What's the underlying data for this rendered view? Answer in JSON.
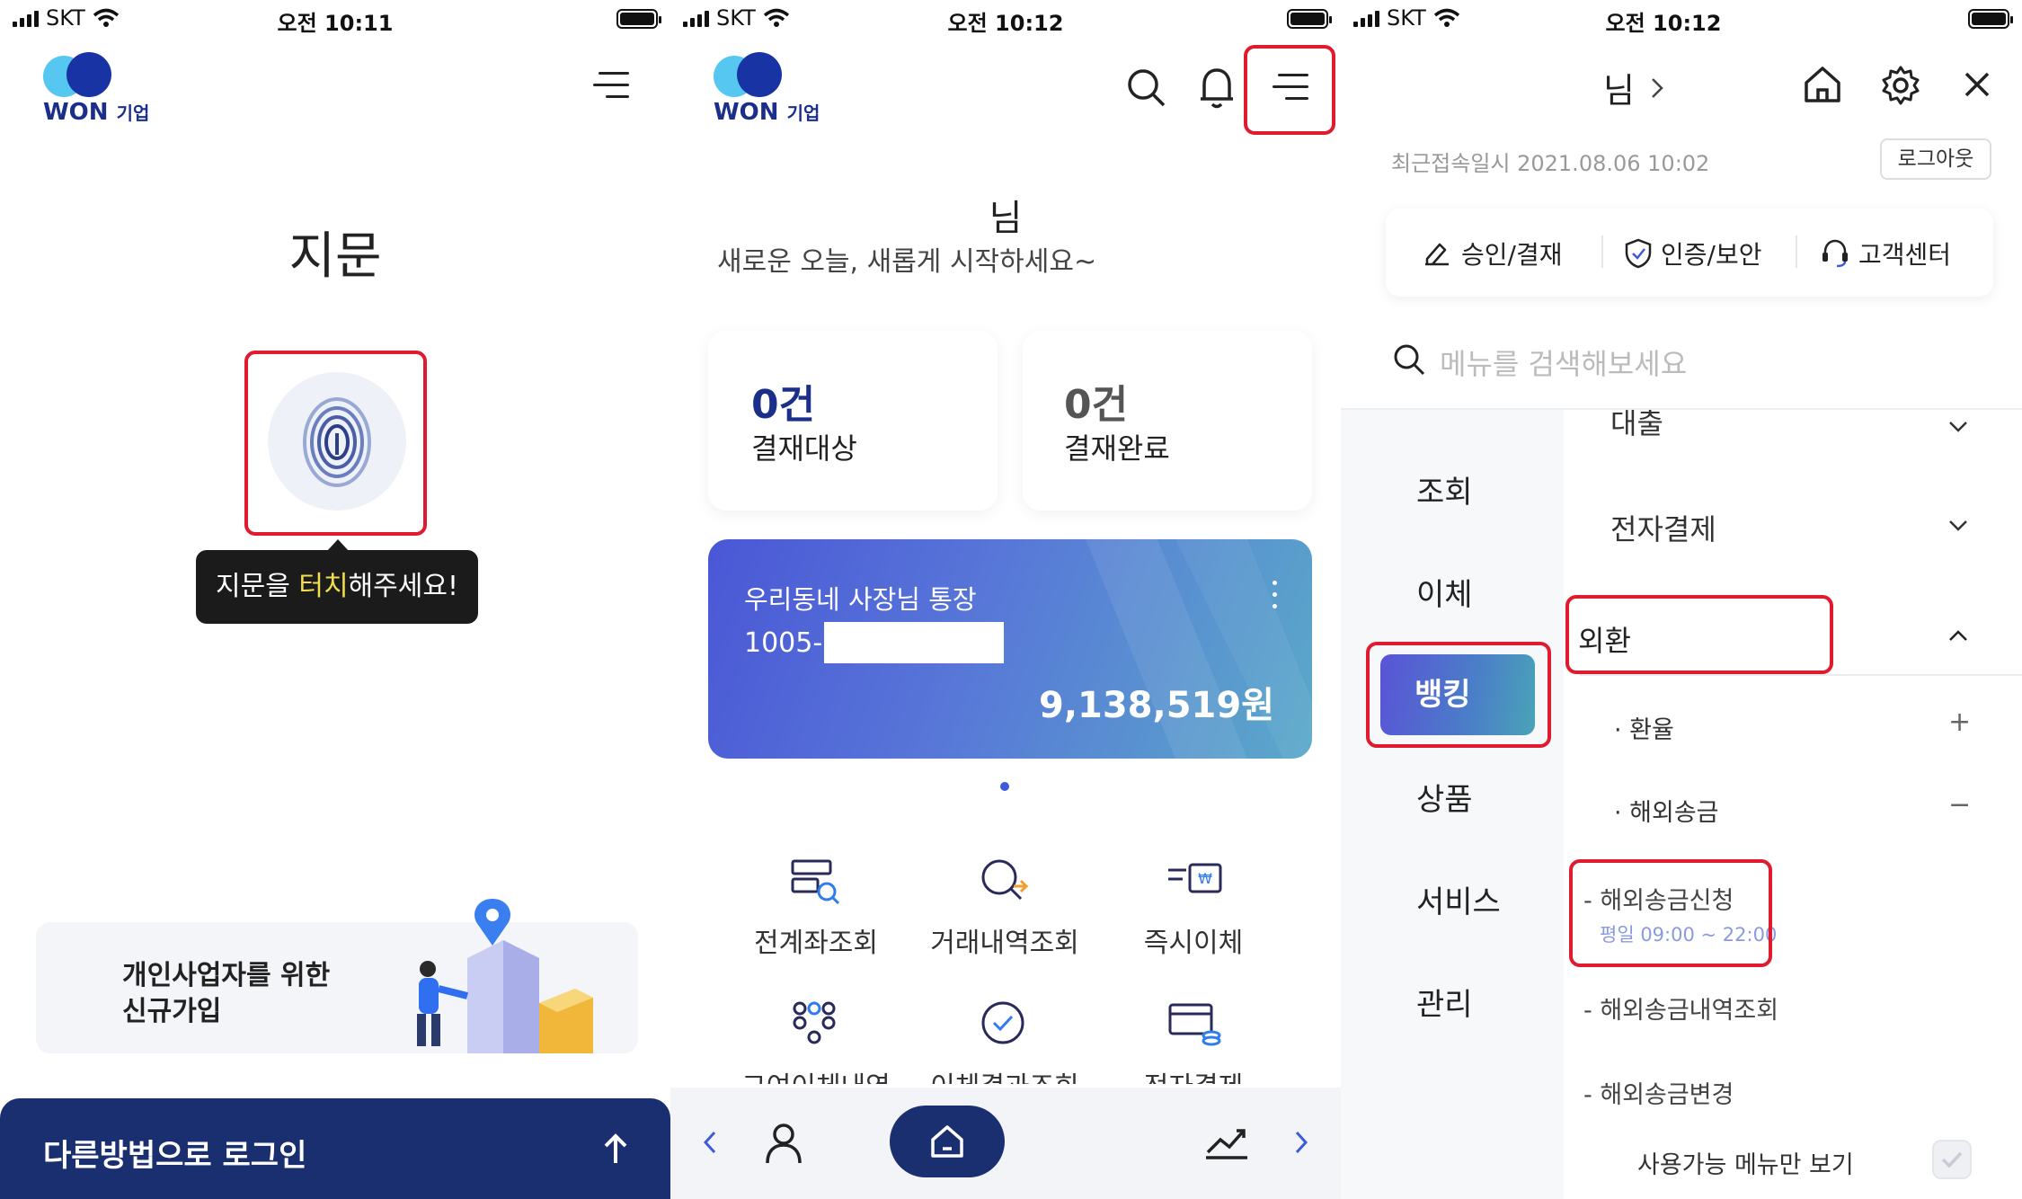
{
  "status_bars": [
    {
      "carrier": "SKT",
      "time": "오전 10:11"
    },
    {
      "carrier": "SKT",
      "time": "오전 10:12"
    },
    {
      "carrier": "SKT",
      "time": "오전 10:12"
    }
  ],
  "brand": {
    "won": "WON",
    "suffix": "기업"
  },
  "panel1": {
    "title": "지문",
    "tooltip_pre": "지문을 ",
    "tooltip_highlight": "터치",
    "tooltip_post": "해주세요!",
    "signup_line1": "개인사업자를 위한",
    "signup_line2": "신규가입",
    "other_login": "다른방법으로 로그인",
    "other_login_icon": "arrow-up-icon"
  },
  "panel2": {
    "user_name": "님",
    "greeting": "새로운 오늘, 새롭게 시작하세요~",
    "stats": [
      {
        "count": "0건",
        "label": "결재대상"
      },
      {
        "count": "0건",
        "label": "결재완료"
      }
    ],
    "account": {
      "name": "우리동네 사장님 통장",
      "number_prefix": "1005-",
      "balance": "9,138,519원"
    },
    "quick_menu_row1": [
      "전계좌조회",
      "거래내역조회",
      "즉시이체"
    ],
    "quick_menu_row2": [
      "그여이체내역",
      "이체결과조회",
      "전자결제"
    ],
    "colors": {
      "card_start": "#4a57d6",
      "card_end": "#5aa9c9",
      "accent": "#1a2e8a"
    }
  },
  "panel3": {
    "user_name": "님",
    "last_access": "최근접속일시 2021.08.06 10:02",
    "logout": "로그아웃",
    "shortcuts": [
      "승인/결재",
      "인증/보안",
      "고객센터"
    ],
    "search_placeholder": "메뉴를 검색해보세요",
    "side_menu": [
      "조회",
      "이체",
      "뱅킹",
      "상품",
      "서비스",
      "관리"
    ],
    "active_side": "뱅킹",
    "groups": [
      {
        "label": "대출",
        "state": "collapsed"
      },
      {
        "label": "전자결제",
        "state": "collapsed"
      },
      {
        "label": "외환",
        "state": "expanded"
      }
    ],
    "sub_items": [
      {
        "label": "· 환율",
        "toggle": "+"
      },
      {
        "label": "· 해외송금",
        "toggle": "−"
      }
    ],
    "leaf_items": [
      {
        "label": "- 해외송금신청",
        "hours": "평일 09:00 ~ 22:00"
      },
      {
        "label": "- 해외송금내역조회"
      },
      {
        "label": "- 해외송금변경"
      }
    ],
    "available_only": "사용가능 메뉴만 보기"
  }
}
